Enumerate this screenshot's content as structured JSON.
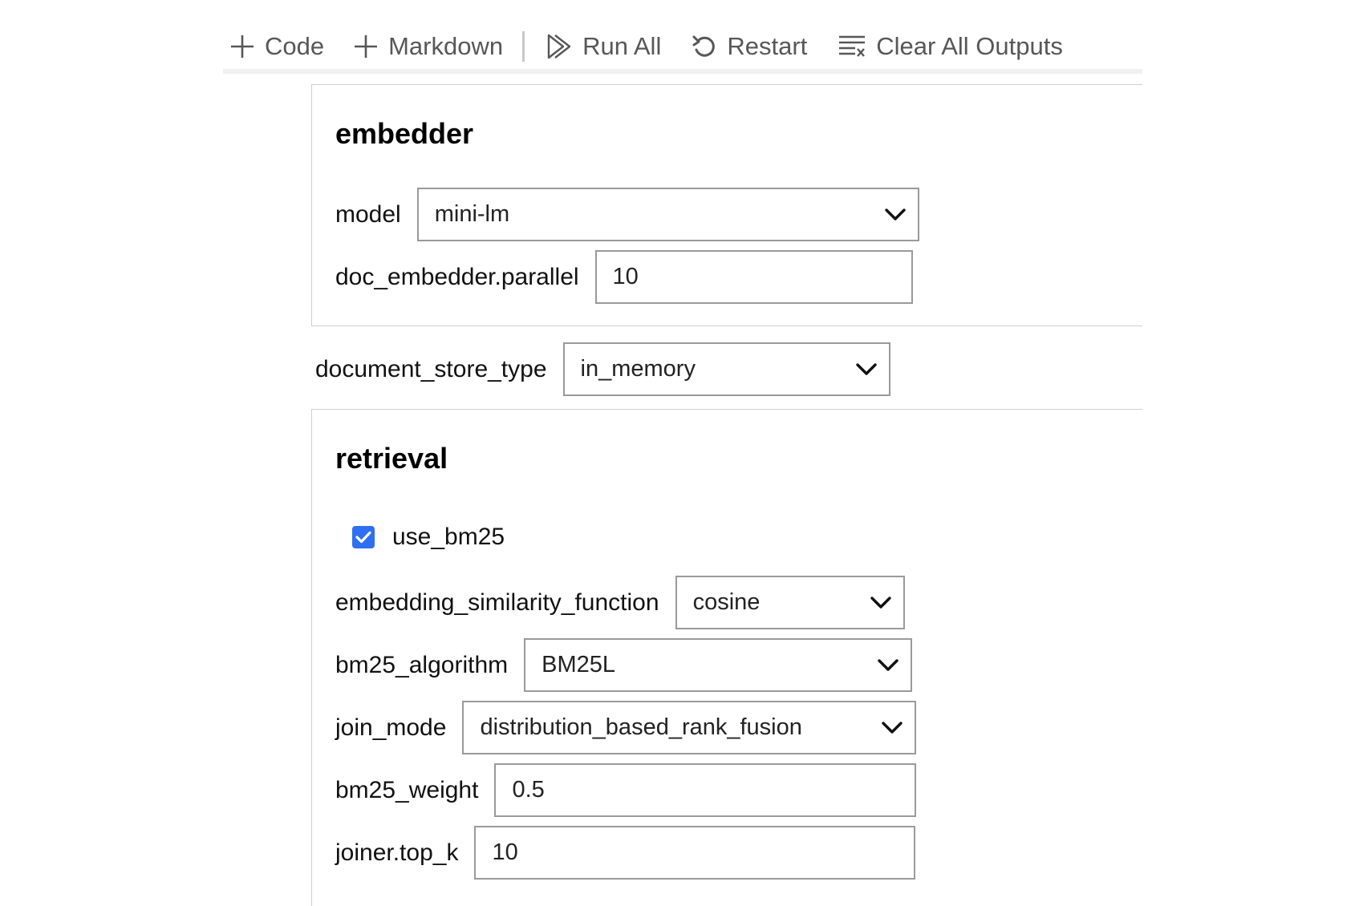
{
  "toolbar": {
    "code_label": "Code",
    "markdown_label": "Markdown",
    "run_all_label": "Run All",
    "restart_label": "Restart",
    "clear_outputs_label": "Clear All Outputs"
  },
  "embedder": {
    "title": "embedder",
    "model": {
      "label": "model",
      "value": "mini-lm"
    },
    "parallel": {
      "label": "doc_embedder.parallel",
      "value": "10"
    }
  },
  "document_store": {
    "label": "document_store_type",
    "value": "in_memory"
  },
  "retrieval": {
    "title": "retrieval",
    "use_bm25": {
      "label": "use_bm25",
      "checked": true
    },
    "similarity": {
      "label": "embedding_similarity_function",
      "value": "cosine"
    },
    "bm25_algorithm": {
      "label": "bm25_algorithm",
      "value": "BM25L"
    },
    "join_mode": {
      "label": "join_mode",
      "value": "distribution_based_rank_fusion"
    },
    "bm25_weight": {
      "label": "bm25_weight",
      "value": "0.5"
    },
    "top_k": {
      "label": "joiner.top_k",
      "value": "10"
    }
  },
  "colors": {
    "checkbox_accent": "#2f6ff2",
    "toolbar_text": "#575757"
  }
}
